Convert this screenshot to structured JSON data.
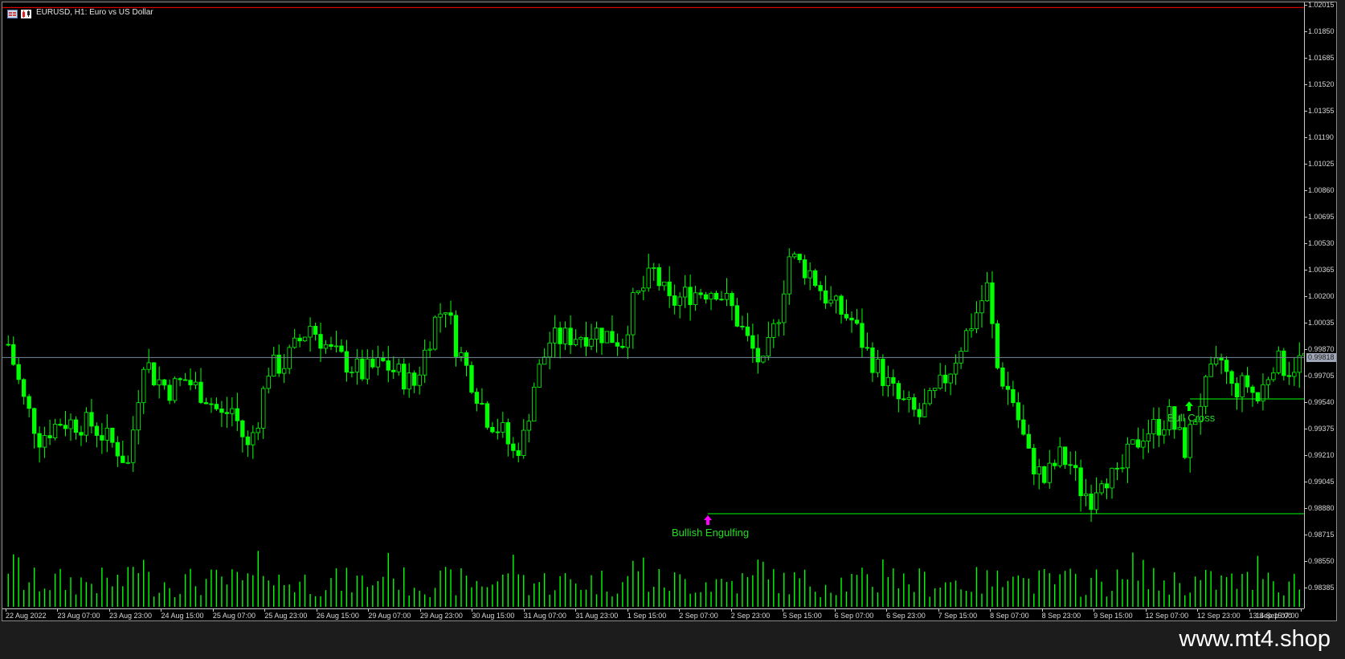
{
  "chart_header": {
    "title": "EURUSD, H1:  Euro vs US Dollar",
    "icons": [
      "chart-window-icon",
      "candlestick-chart-icon"
    ]
  },
  "watermark": "www.mt4.shop",
  "colors": {
    "background": "#000000",
    "bull_candle": "#00ff00",
    "volume": "#00ff00",
    "bid_line": "#778899",
    "high_line": "#ff0000",
    "support_line": "#00ff00",
    "bullish_engulfing_arrow": "#ff00ff",
    "bull_cross_arrow": "#00ff00",
    "signal_text": "#00ff00"
  },
  "chart_data": {
    "type": "candlestick",
    "symbol": "EURUSD",
    "timeframe": "H1",
    "current_price": "0.99818",
    "ylim": [
      0.98255,
      1.0203
    ],
    "y_ticks": [
      "1.02015",
      "1.01850",
      "1.01685",
      "1.01520",
      "1.01355",
      "1.01190",
      "1.01025",
      "1.00860",
      "1.00695",
      "1.00530",
      "1.00365",
      "1.00200",
      "1.00035",
      "0.99870",
      "0.99705",
      "0.99540",
      "0.99375",
      "0.99210",
      "0.99045",
      "0.98880",
      "0.98715",
      "0.98550",
      "0.98385"
    ],
    "x_ticks": [
      "22 Aug 2022",
      "23 Aug 07:00",
      "23 Aug 23:00",
      "24 Aug 15:00",
      "25 Aug 07:00",
      "25 Aug 23:00",
      "26 Aug 15:00",
      "29 Aug 07:00",
      "29 Aug 23:00",
      "30 Aug 15:00",
      "31 Aug 07:00",
      "31 Aug 23:00",
      "1 Sep 15:00",
      "2 Sep 07:00",
      "2 Sep 23:00",
      "5 Sep 15:00",
      "6 Sep 07:00",
      "6 Sep 23:00",
      "7 Sep 15:00",
      "8 Sep 07:00",
      "8 Sep 23:00",
      "9 Sep 15:00",
      "12 Sep 07:00",
      "12 Sep 23:00",
      "13 Sep 15:00",
      "14 Sep 07:00"
    ],
    "bar_count": 250,
    "price_path": [
      [
        0,
        0.999
      ],
      [
        3,
        0.9955
      ],
      [
        6,
        0.9932
      ],
      [
        10,
        0.9942
      ],
      [
        16,
        0.994
      ],
      [
        21,
        0.9925
      ],
      [
        23,
        0.9915
      ],
      [
        26,
        0.9982
      ],
      [
        28,
        0.997
      ],
      [
        31,
        0.9962
      ],
      [
        34,
        0.9968
      ],
      [
        38,
        0.9958
      ],
      [
        41,
        0.9945
      ],
      [
        43,
        0.995
      ],
      [
        46,
        0.9925
      ],
      [
        48,
        0.9945
      ],
      [
        50,
        0.9975
      ],
      [
        53,
        0.9978
      ],
      [
        58,
        1.0002
      ],
      [
        62,
        0.9985
      ],
      [
        68,
        0.9972
      ],
      [
        72,
        0.9978
      ],
      [
        78,
        0.9965
      ],
      [
        82,
        1.0005
      ],
      [
        84,
        1.0015
      ],
      [
        86,
        0.999
      ],
      [
        89,
        0.9968
      ],
      [
        92,
        0.9945
      ],
      [
        95,
        0.9935
      ],
      [
        97,
        0.9922
      ],
      [
        99,
        0.9932
      ],
      [
        101,
        0.9965
      ],
      [
        104,
        0.9992
      ],
      [
        108,
        0.9995
      ],
      [
        113,
        0.9998
      ],
      [
        118,
        0.9992
      ],
      [
        120,
        1.0015
      ],
      [
        124,
        1.0035
      ],
      [
        127,
        1.0015
      ],
      [
        131,
        1.0022
      ],
      [
        136,
        1.0025
      ],
      [
        139,
        1.0012
      ],
      [
        142,
        0.9992
      ],
      [
        145,
        0.9975
      ],
      [
        148,
        1.001
      ],
      [
        150,
        1.0045
      ],
      [
        154,
        1.0035
      ],
      [
        158,
        1.0015
      ],
      [
        162,
        1.0005
      ],
      [
        165,
        0.9985
      ],
      [
        168,
        0.997
      ],
      [
        171,
        0.9955
      ],
      [
        175,
        0.9945
      ],
      [
        178,
        0.9958
      ],
      [
        181,
        0.9975
      ],
      [
        183,
        0.999
      ],
      [
        186,
        1.001
      ],
      [
        188,
        1.0025
      ],
      [
        190,
        0.9975
      ],
      [
        193,
        0.9955
      ],
      [
        196,
        0.992
      ],
      [
        199,
        0.9905
      ],
      [
        202,
        0.992
      ],
      [
        204,
        0.9915
      ],
      [
        206,
        0.99
      ],
      [
        208,
        0.9895
      ],
      [
        210,
        0.991
      ],
      [
        213,
        0.9905
      ],
      [
        215,
        0.992
      ],
      [
        218,
        0.9935
      ],
      [
        221,
        0.994
      ],
      [
        223,
        0.9945
      ],
      [
        226,
        0.9925
      ],
      [
        229,
        0.9955
      ],
      [
        231,
        0.997
      ],
      [
        233,
        0.998
      ],
      [
        235,
        0.9962
      ],
      [
        238,
        0.9965
      ],
      [
        240,
        0.9955
      ],
      [
        243,
        0.998
      ],
      [
        246,
        0.9975
      ],
      [
        249,
        0.9982
      ]
    ],
    "annotations": [
      {
        "label": "Bullish Engulfing",
        "price": 0.98845,
        "arrow": "up",
        "color": "#ff00ff"
      },
      {
        "label": "Bull Cross",
        "price": 0.9956,
        "arrow": "up",
        "color": "#00ff00"
      }
    ],
    "horizontal_lines": [
      {
        "name": "bid-line",
        "price": 0.99818
      },
      {
        "name": "high-line",
        "price": 1.01998
      },
      {
        "name": "support-line",
        "price": 0.98845
      },
      {
        "name": "bull-cross-line",
        "price": 0.9956
      }
    ],
    "grid": false,
    "volume_histogram": true
  }
}
